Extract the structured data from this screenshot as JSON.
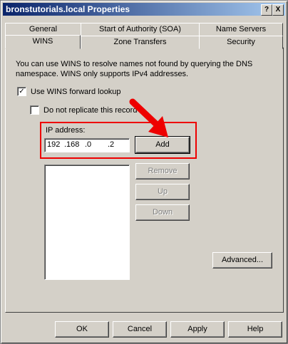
{
  "window": {
    "title": "bronstutorials.local Properties",
    "help_btn": "?",
    "close_btn": "X"
  },
  "tabs": {
    "row_back": [
      "General",
      "Start of Authority (SOA)",
      "Name Servers"
    ],
    "row_front": [
      "WINS",
      "Zone Transfers",
      "Security"
    ],
    "active": "WINS"
  },
  "panel": {
    "description": "You can use WINS to resolve names not found by querying the DNS namespace.  WINS only supports IPv4 addresses.",
    "use_wins_label": "Use WINS forward lookup",
    "use_wins_checked": true,
    "no_replicate_label": "Do not replicate this record",
    "no_replicate_checked": false,
    "ip_label": "IP address:",
    "ip_segments": [
      "192",
      ".168",
      ".0",
      ".2"
    ],
    "buttons": {
      "add": "Add",
      "remove": "Remove",
      "up": "Up",
      "down": "Down",
      "advanced": "Advanced..."
    }
  },
  "footer": {
    "ok": "OK",
    "cancel": "Cancel",
    "apply": "Apply",
    "help": "Help"
  },
  "colors": {
    "annotation": "#e00000",
    "titlebar": "#0a246a"
  }
}
